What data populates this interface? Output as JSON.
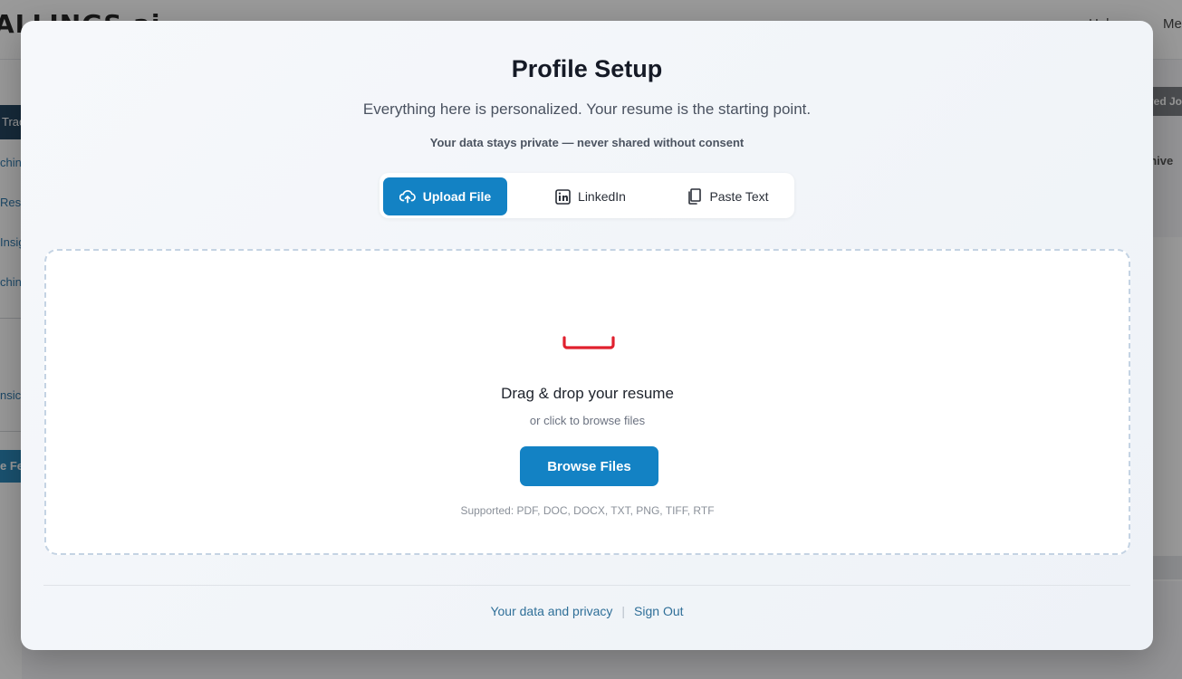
{
  "background": {
    "logo": "ALLINGS.ai",
    "header_help": "Help",
    "header_menu": "Me",
    "sidebar": [
      "Trac",
      "chin",
      "Resu",
      "Insig",
      "chin",
      "nsic",
      "e Fe"
    ],
    "right_button": "ved Jo",
    "right_link": "chive"
  },
  "modal": {
    "title": "Profile Setup",
    "subtitle": "Everything here is personalized. Your resume is the starting point.",
    "privacy_note": "Your data stays private — never shared without consent",
    "tabs": {
      "upload": "Upload File",
      "linkedin": "LinkedIn",
      "paste": "Paste Text",
      "active": "upload"
    },
    "dropzone": {
      "title": "Drag & drop your resume",
      "subtitle": "or click to browse files",
      "button": "Browse Files",
      "supported": "Supported: PDF, DOC, DOCX, TXT, PNG, TIFF, RTF"
    },
    "footer": {
      "privacy_link": "Your data and privacy",
      "separator": "|",
      "sign_out": "Sign Out"
    }
  },
  "colors": {
    "accent": "#1382c4",
    "upload_icon": "#e0202e",
    "link": "#2f6f98"
  }
}
